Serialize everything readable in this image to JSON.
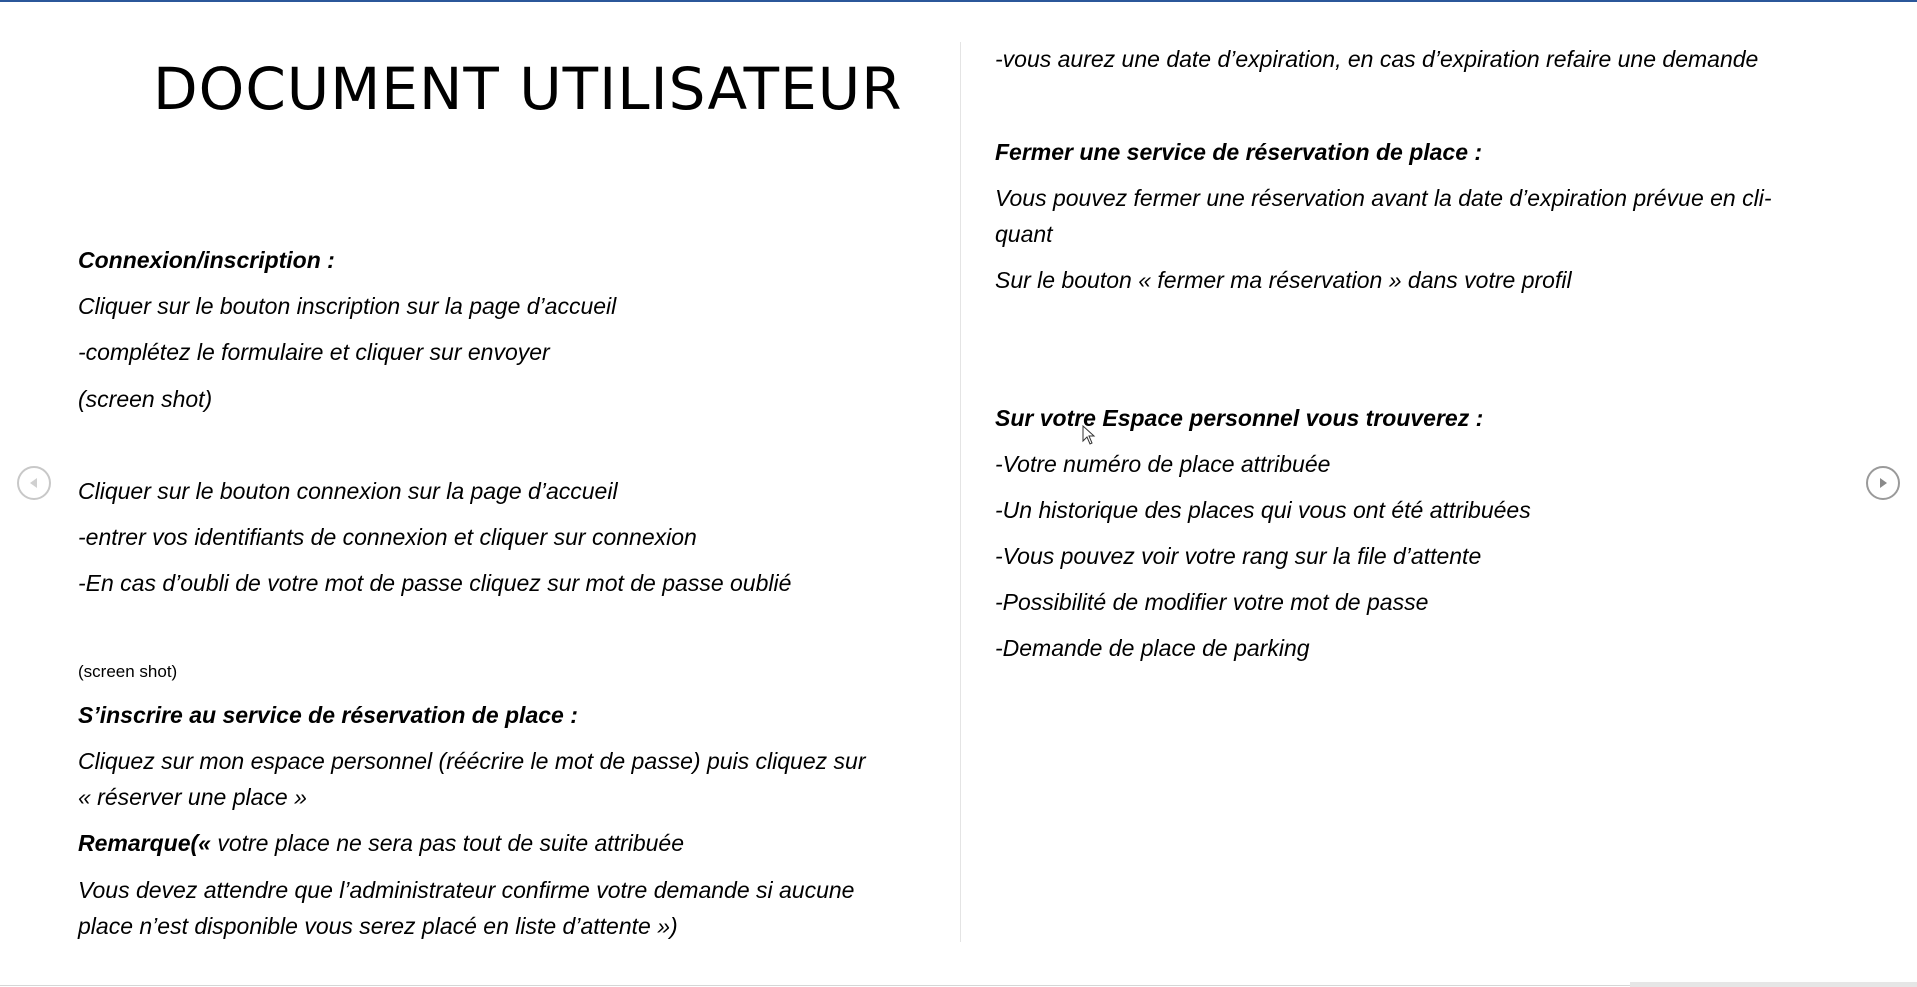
{
  "document": {
    "title": "DOCUMENT UTILISATEUR",
    "left": {
      "section1_heading": "Connexion/inscription :",
      "s1_p1": "Cliquer sur le bouton inscription sur la page d’accueil",
      "s1_p2": "-complétez le formulaire et cliquer sur envoyer",
      "s1_p3": "(screen shot)",
      "s1_p4": "Cliquer sur le bouton connexion sur la page d’accueil",
      "s1_p5": "-entrer vos identifiants de connexion et cliquer sur connexion",
      "s1_p6": "-En cas d’oubli de votre mot de passe cliquez sur mot de passe oublié",
      "s1_p7": "(screen shot)",
      "section2_heading": "S’inscrire au service de réservation de place :",
      "s2_p1_line1": "Cliquez sur mon espace personnel (réécrire le mot de passe) puis cliquez sur",
      "s2_p1_line2": "« réserver une place »",
      "s2_remark_label": "Remarque(« ",
      "s2_remark_text": "votre place ne sera pas tout de suite attribuée",
      "s2_p3_line1": "Vous devez attendre que l’administrateur confirme votre demande si aucune",
      "s2_p3_line2": "place n’est disponible vous serez placé en liste d’attente »)"
    },
    "right": {
      "r_p1": "-vous aurez une date d’expiration, en cas d’expiration refaire une demande",
      "section3_heading": "Fermer une service de réservation de place :",
      "s3_p1_line1": "Vous pouvez fermer une réservation avant la date d’expiration prévue en cli-",
      "s3_p1_line2": "quant",
      "s3_p2": "Sur le bouton « fermer ma réservation » dans votre profil",
      "section4_heading": "Sur votre Espace personnel vous trouverez :",
      "s4_items": [
        "-Votre numéro de place attribuée",
        "-Un historique des places qui vous ont été attribuées",
        "-Vous pouvez voir votre rang sur la file d’attente",
        "-Possibilité de modifier votre mot de passe",
        "-Demande de place de parking"
      ]
    }
  },
  "navigation": {
    "prev_icon": "chevron-left-icon",
    "next_icon": "chevron-right-icon"
  },
  "colors": {
    "accent": "#2b579a",
    "text": "#000000",
    "divider": "#e4e4e4"
  }
}
